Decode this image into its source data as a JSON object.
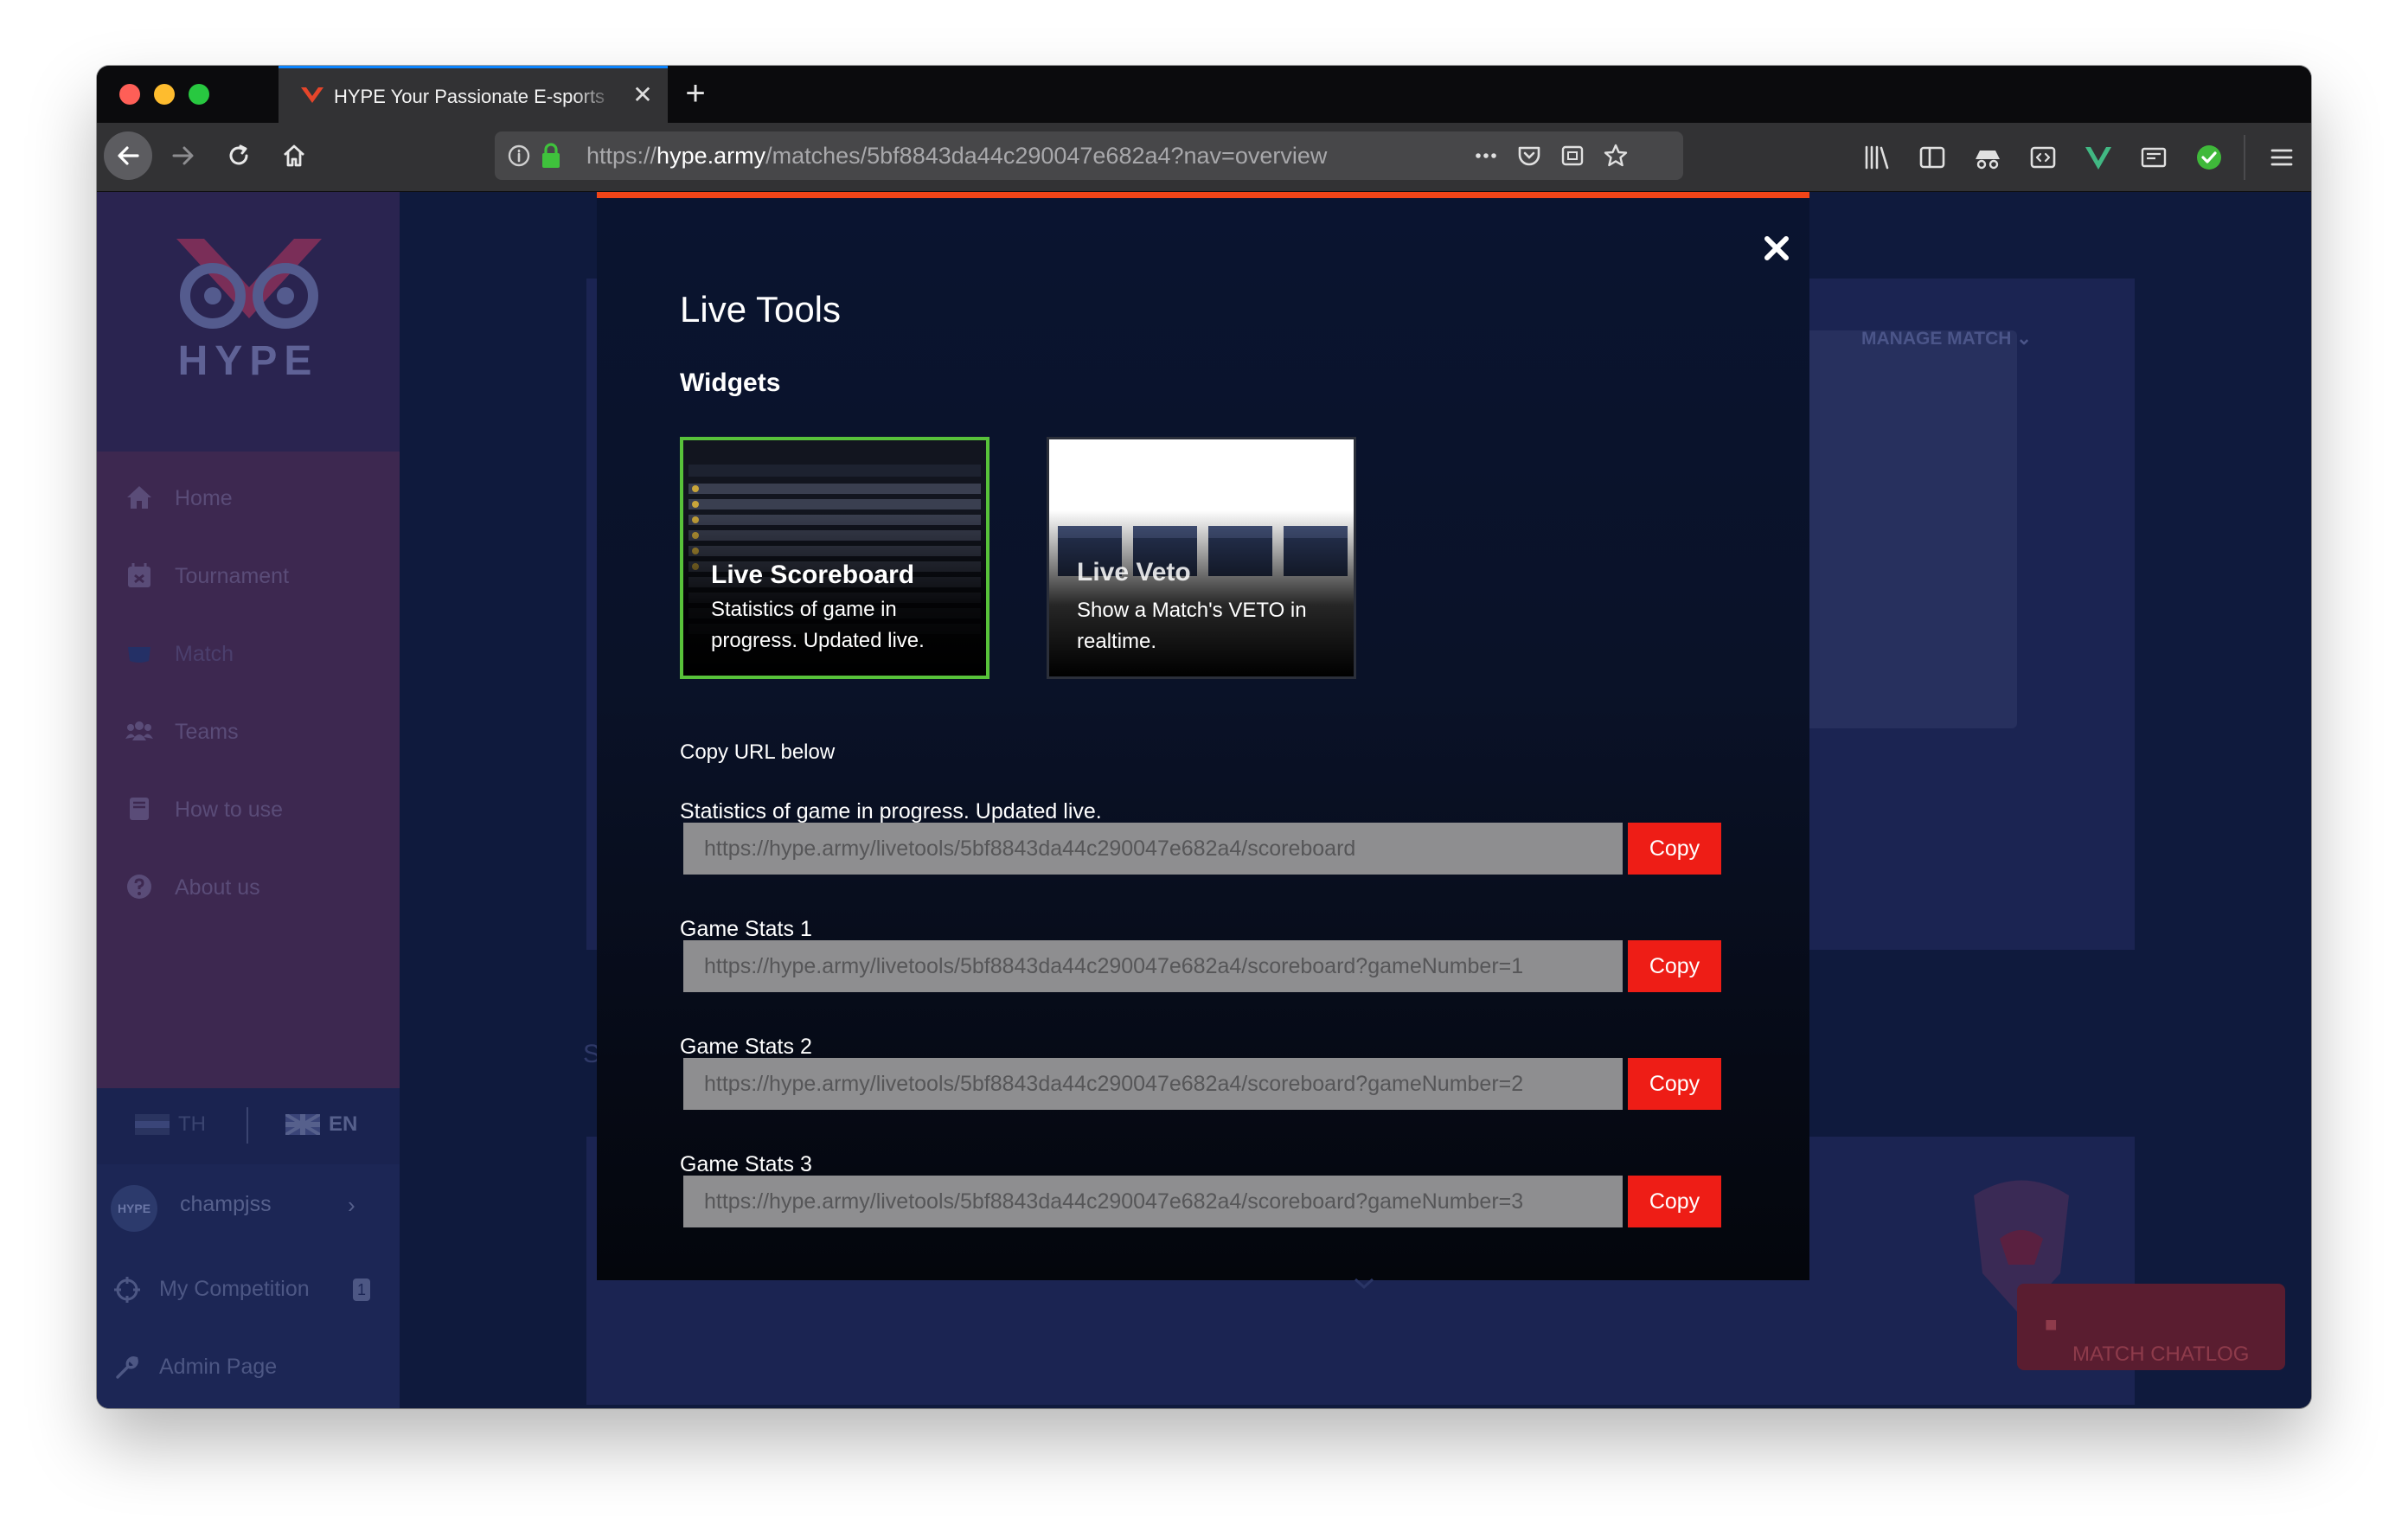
{
  "browser": {
    "tab_title": "HYPE Your Passionate E-sports",
    "url_prefix": "https://",
    "url_domain": "hype.army",
    "url_path": "/matches/5bf8843da44c290047e682a4?nav=overview"
  },
  "sidebar": {
    "logo_text": "HYPE",
    "menu": [
      {
        "label": "Home",
        "icon": "home-icon"
      },
      {
        "label": "Tournament",
        "icon": "calendar-icon"
      },
      {
        "label": "Match",
        "icon": "controller-icon"
      },
      {
        "label": "Teams",
        "icon": "users-icon"
      },
      {
        "label": "How to use",
        "icon": "book-icon"
      },
      {
        "label": "About us",
        "icon": "question-icon"
      }
    ],
    "lang_th": "TH",
    "lang_en": "EN",
    "avatar_text": "HYPE",
    "user_name": "champjss",
    "my_competition": "My Competition",
    "my_competition_badge": "1",
    "admin_page": "Admin Page"
  },
  "background": {
    "manage_match": "MANAGE MATCH",
    "section_letter": "S",
    "match_chatlog": "MATCH CHATLOG"
  },
  "modal": {
    "title": "Live Tools",
    "widgets_heading": "Widgets",
    "widgets": [
      {
        "name": "Live Scoreboard",
        "description": "Statistics of game in progress. Updated live."
      },
      {
        "name": "Live Veto",
        "description": "Show a Match's VETO in realtime."
      }
    ],
    "copy_hint": "Copy URL below",
    "urls": [
      {
        "label": "Statistics of game in progress. Updated live.",
        "value": "https://hype.army/livetools/5bf8843da44c290047e682a4/scoreboard",
        "button": "Copy"
      },
      {
        "label": "Game Stats 1",
        "value": "https://hype.army/livetools/5bf8843da44c290047e682a4/scoreboard?gameNumber=1",
        "button": "Copy"
      },
      {
        "label": "Game Stats 2",
        "value": "https://hype.army/livetools/5bf8843da44c290047e682a4/scoreboard?gameNumber=2",
        "button": "Copy"
      },
      {
        "label": "Game Stats 3",
        "value": "https://hype.army/livetools/5bf8843da44c290047e682a4/scoreboard?gameNumber=3",
        "button": "Copy"
      }
    ]
  },
  "colors": {
    "accent_orange": "#f04418",
    "copy_red": "#ee1d16",
    "selected_green": "#58c23a",
    "page_navy": "#0f1a3d"
  }
}
